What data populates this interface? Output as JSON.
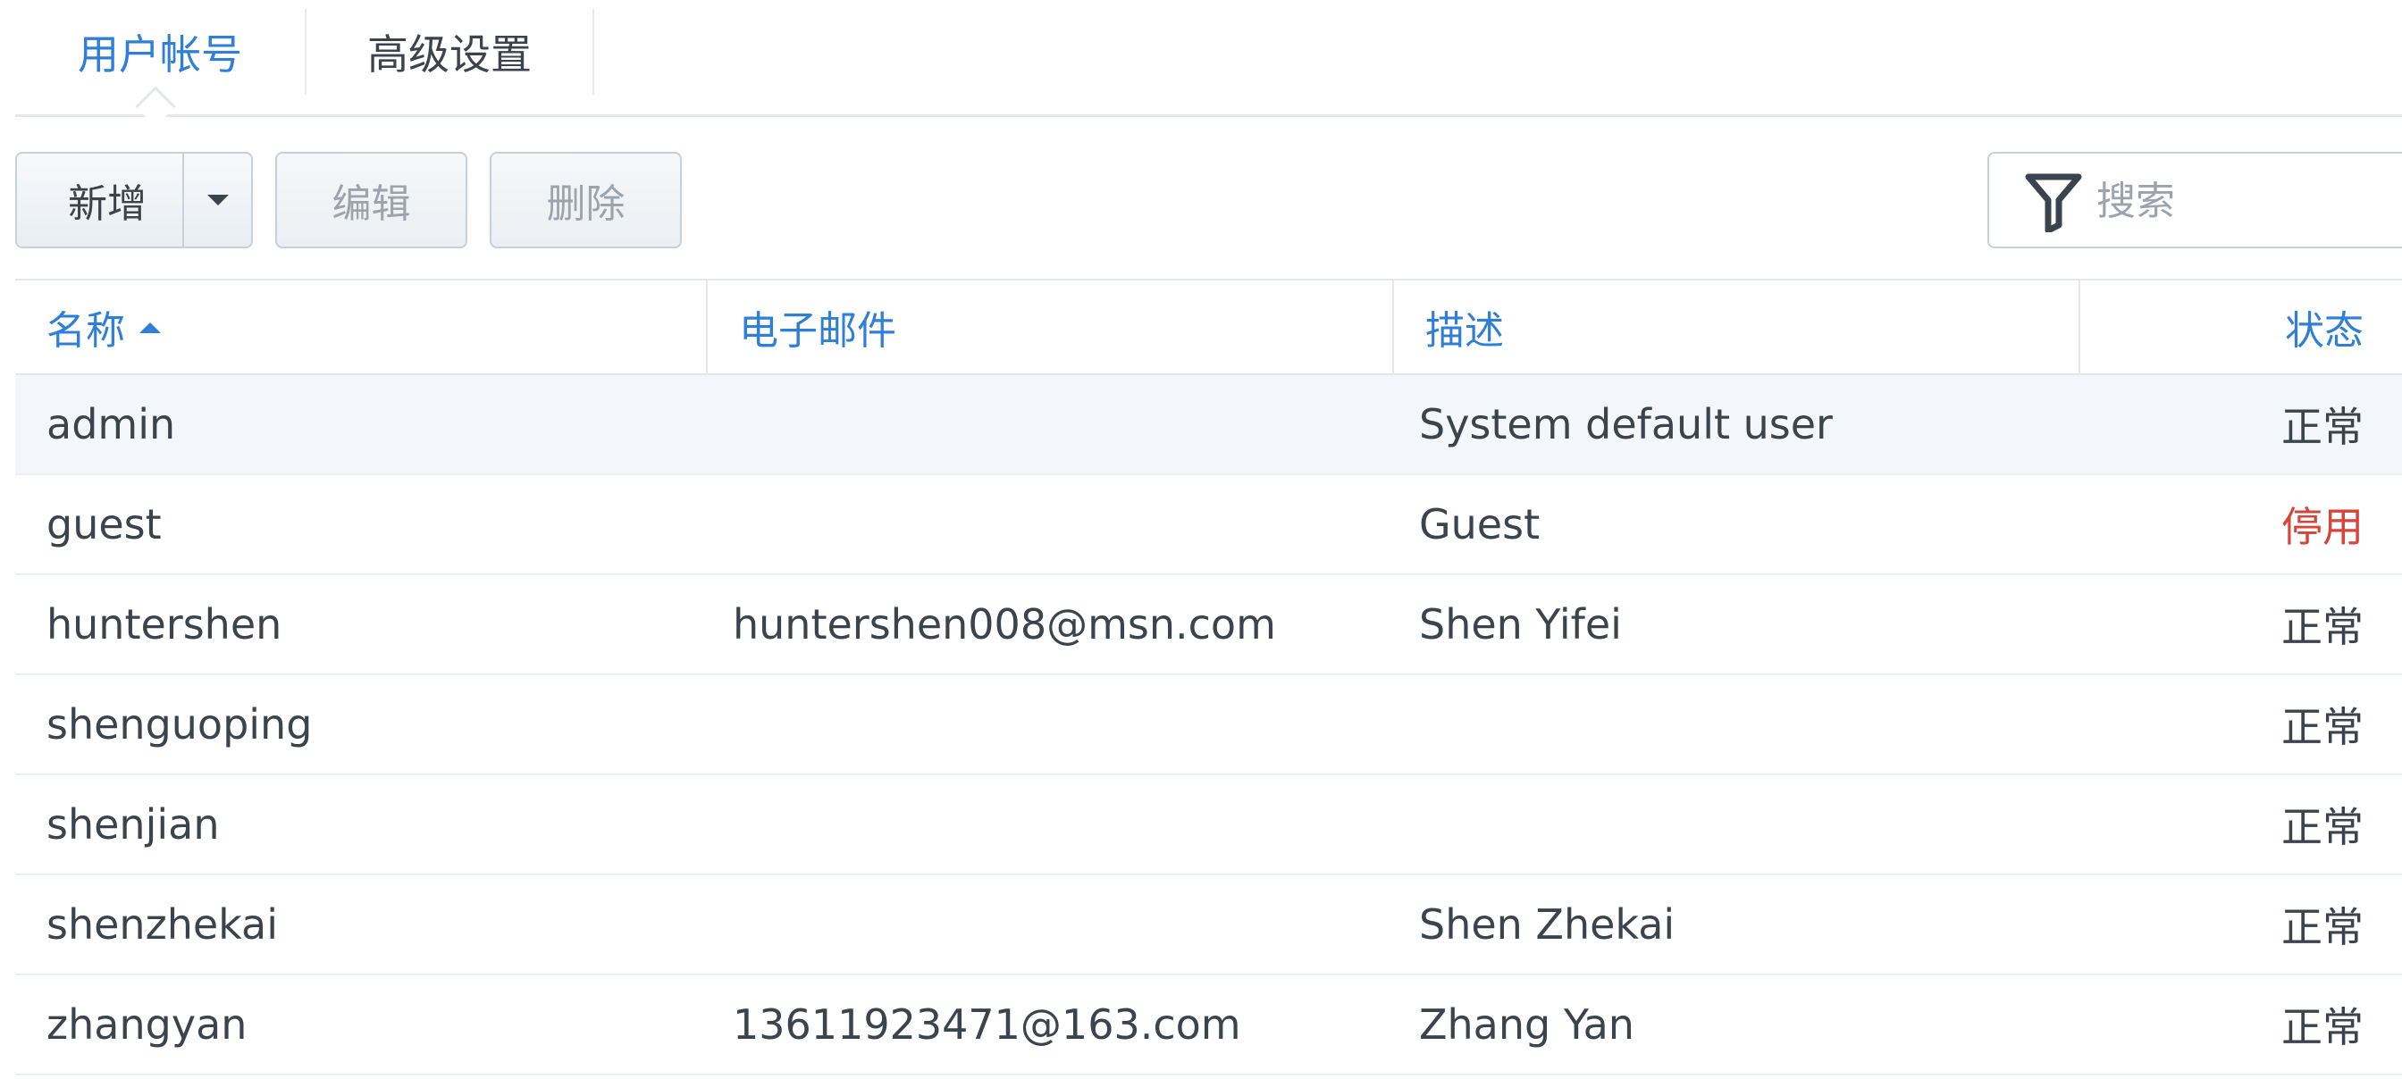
{
  "tabs": [
    {
      "label": "用户帐号",
      "active": true
    },
    {
      "label": "高级设置",
      "active": false
    }
  ],
  "toolbar": {
    "add_label": "新增",
    "edit_label": "编辑",
    "delete_label": "删除",
    "search_placeholder": "搜索",
    "search_value": ""
  },
  "table": {
    "columns": {
      "name": "名称",
      "email": "电子邮件",
      "description": "描述",
      "status": "状态"
    },
    "sort": {
      "column": "name",
      "direction": "ascending"
    },
    "rows": [
      {
        "name": "admin",
        "email": "",
        "description": "System default user",
        "status": "正常"
      },
      {
        "name": "guest",
        "email": "",
        "description": "Guest",
        "status": "停用"
      },
      {
        "name": "huntershen",
        "email": "huntershen008@msn.com",
        "description": "Shen Yifei",
        "status": "正常"
      },
      {
        "name": "shenguoping",
        "email": "",
        "description": "",
        "status": "正常"
      },
      {
        "name": "shenjian",
        "email": "",
        "description": "",
        "status": "正常"
      },
      {
        "name": "shenzhekai",
        "email": "",
        "description": "Shen Zhekai",
        "status": "正常"
      },
      {
        "name": "zhangyan",
        "email": "13611923471@163.com",
        "description": "Zhang Yan",
        "status": "正常"
      }
    ]
  },
  "colors": {
    "accent": "#2f7fd6",
    "text": "#3b434d",
    "disabled_status": "#d4453c",
    "selected_row": "#f3f7fc"
  }
}
